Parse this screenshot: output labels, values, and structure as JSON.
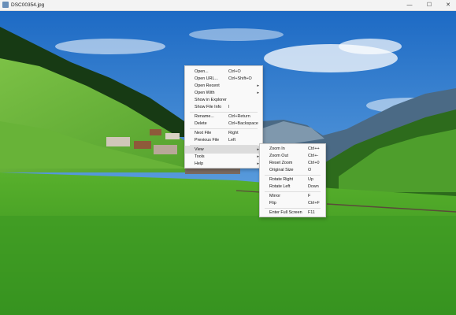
{
  "window": {
    "title": "DSC00354.jpg",
    "controls": {
      "minimize": "—",
      "maximize": "☐",
      "close": "✕"
    }
  },
  "context_menu": {
    "items": [
      {
        "label": "Open...",
        "shortcut": "Ctrl+O"
      },
      {
        "label": "Open URL...",
        "shortcut": "Ctrl+Shift+O"
      },
      {
        "label": "Open Recent",
        "submenu_arrow": "▸"
      },
      {
        "label": "Open With",
        "submenu_arrow": "▸"
      },
      {
        "label": "Show in Explorer",
        "shortcut": ""
      },
      {
        "label": "Show File Info",
        "shortcut": "I"
      },
      {
        "label": "Rename...",
        "shortcut": "Ctrl+Return"
      },
      {
        "label": "Delete",
        "shortcut": "Ctrl+Backspace"
      },
      {
        "label": "Next File",
        "shortcut": "Right"
      },
      {
        "label": "Previous File",
        "shortcut": "Left"
      },
      {
        "label": "View",
        "submenu_arrow": "▸"
      },
      {
        "label": "Tools",
        "submenu_arrow": "▸"
      },
      {
        "label": "Help",
        "submenu_arrow": "▸"
      }
    ]
  },
  "view_submenu": {
    "items": [
      {
        "label": "Zoom In",
        "shortcut": "Ctrl++"
      },
      {
        "label": "Zoom Out",
        "shortcut": "Ctrl+-"
      },
      {
        "label": "Reset Zoom",
        "shortcut": "Ctrl+0"
      },
      {
        "label": "Original Size",
        "shortcut": "O"
      },
      {
        "label": "Rotate Right",
        "shortcut": "Up"
      },
      {
        "label": "Rotate Left",
        "shortcut": "Down"
      },
      {
        "label": "Mirror",
        "shortcut": "F"
      },
      {
        "label": "Flip",
        "shortcut": "Ctrl+F"
      },
      {
        "label": "Enter Full Screen",
        "shortcut": "F11"
      }
    ]
  },
  "colors": {
    "sky_top": "#1f6fc8",
    "sky_bottom": "#9cc6ea",
    "meadow": "#3f9a22",
    "forest": "#173a14",
    "menu_bg": "#f9f9f9",
    "menu_highlight": "#dcdcdc"
  }
}
